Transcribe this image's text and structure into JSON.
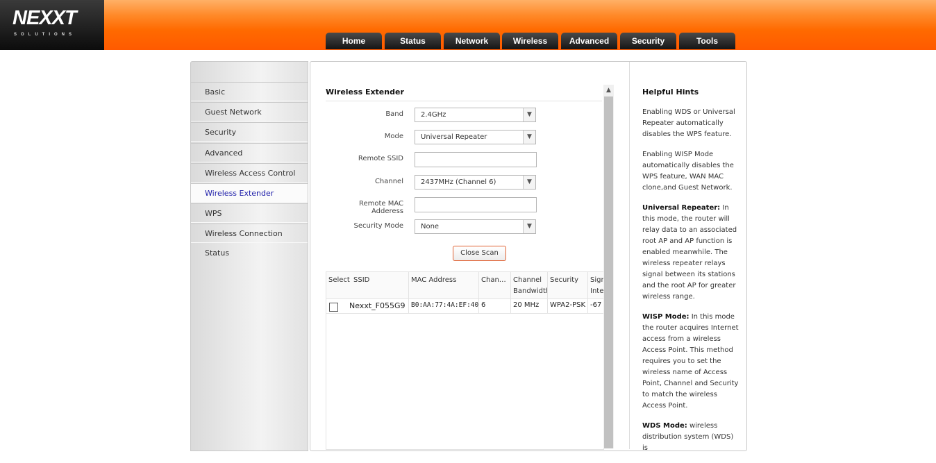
{
  "brand": {
    "logo": "NEXXT",
    "logo_sub": "SOLUTIONS"
  },
  "nav": {
    "tabs": [
      "Home",
      "Status",
      "Network",
      "Wireless",
      "Advanced",
      "Security",
      "Tools"
    ]
  },
  "sidebar": {
    "items": [
      {
        "label": "Basic",
        "active": false
      },
      {
        "label": "Guest Network",
        "active": false
      },
      {
        "label": "Security",
        "active": false
      },
      {
        "label": "Advanced",
        "active": false
      },
      {
        "label": "Wireless Access Control",
        "active": false
      },
      {
        "label": "Wireless Extender",
        "active": true
      },
      {
        "label": "WPS",
        "active": false
      },
      {
        "label": "Wireless Connection Status",
        "active": false
      }
    ]
  },
  "content": {
    "title": "Wireless Extender",
    "band_label": "Band",
    "band_value": "2.4GHz",
    "mode_label": "Mode",
    "mode_value": "Universal Repeater",
    "ssid_label": "Remote SSID",
    "ssid_value": "",
    "channel_label": "Channel",
    "channel_value": "2437MHz (Channel 6)",
    "mac_label": "Remote MAC Adderess",
    "mac_value": "",
    "security_label": "Security Mode",
    "security_value": "None",
    "close_scan": "Close Scan"
  },
  "scan_table": {
    "headers": {
      "select": "Select",
      "ssid": "SSID",
      "mac": "MAC Address",
      "channel": "Chan…",
      "bandwidth_1": "Channel",
      "bandwidth_2": "Bandwidth",
      "security": "Security",
      "signal_1": "Sign",
      "signal_2": "Inte"
    },
    "rows": [
      {
        "ssid": "Nexxt_F055G9",
        "mac": "B0:AA:77:4A:EF:40",
        "channel": "6",
        "bandwidth": "20 MHz",
        "security": "WPA2-PSK",
        "signal": "-67"
      }
    ]
  },
  "hints": {
    "title": "Helpful Hints",
    "p1": "Enabling WDS or Universal Repeater automatically disables the WPS feature.",
    "p2": "Enabling WISP Mode automatically disables the WPS feature, WAN MAC clone,and Guest Network.",
    "p3_label": "Universal Repeater:",
    "p3": " In this mode, the router will relay data to an associated root AP and AP function is enabled meanwhile. The wireless repeater relays signal between its stations and the root AP for greater wireless range.",
    "p4_label": "WISP Mode:",
    "p4": " In this mode the router acquires Internet access from a wireless Access Point. This method requires you to set the wireless name of Access Point, Channel and Security to match the wireless Access Point.",
    "p5_label": "WDS Mode:",
    "p5": " wireless distribution system (WDS) is"
  }
}
